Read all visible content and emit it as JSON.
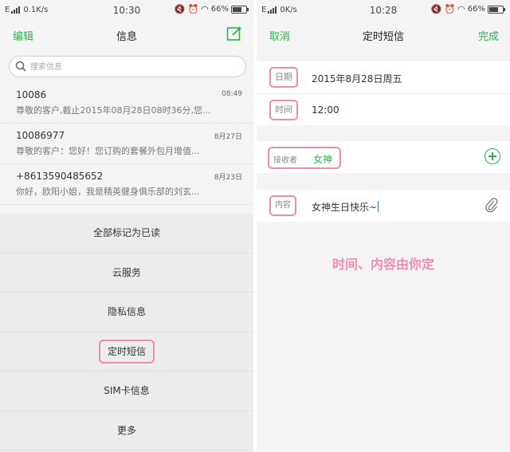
{
  "left_screen": {
    "status": {
      "carrier": "E",
      "speed": "0.1K/s",
      "time": "10:30",
      "battery": "66%"
    },
    "nav": {
      "left": "编辑",
      "title": "信息"
    },
    "search": {
      "placeholder": "搜索信息"
    },
    "messages": [
      {
        "number": "10086",
        "time": "08:49",
        "preview": "尊敬的客户,截止2015年08月28日08时36分,您..."
      },
      {
        "number": "10086977",
        "time": "8月27日",
        "preview": "尊敬的客户：您好！您订购的套餐外包月增值..."
      },
      {
        "number": "+8613590485652",
        "time": "8月23日",
        "preview": "你好，欧阳小姐，我是精英健身俱乐部的刘玄..."
      }
    ],
    "menu": [
      "全部标记为已读",
      "云服务",
      "隐私信息",
      "定时短信",
      "SIM卡信息",
      "更多"
    ]
  },
  "right_screen": {
    "status": {
      "carrier": "E",
      "speed": "0K/s",
      "time": "10:28",
      "battery": "66%"
    },
    "nav": {
      "left": "取消",
      "title": "定时短信",
      "right": "完成"
    },
    "date": {
      "label": "日期",
      "value": "2015年8月28日周五"
    },
    "time": {
      "label": "时间",
      "value": "12:00"
    },
    "recipient": {
      "label": "接收者",
      "name": "女神"
    },
    "content": {
      "label": "内容",
      "value": "女神生日快乐~"
    },
    "annotation": "时间、内容由你定"
  },
  "colors": {
    "accent": "#2db34a",
    "highlight": "#f08bb0",
    "annotation": "#f48cb2"
  }
}
